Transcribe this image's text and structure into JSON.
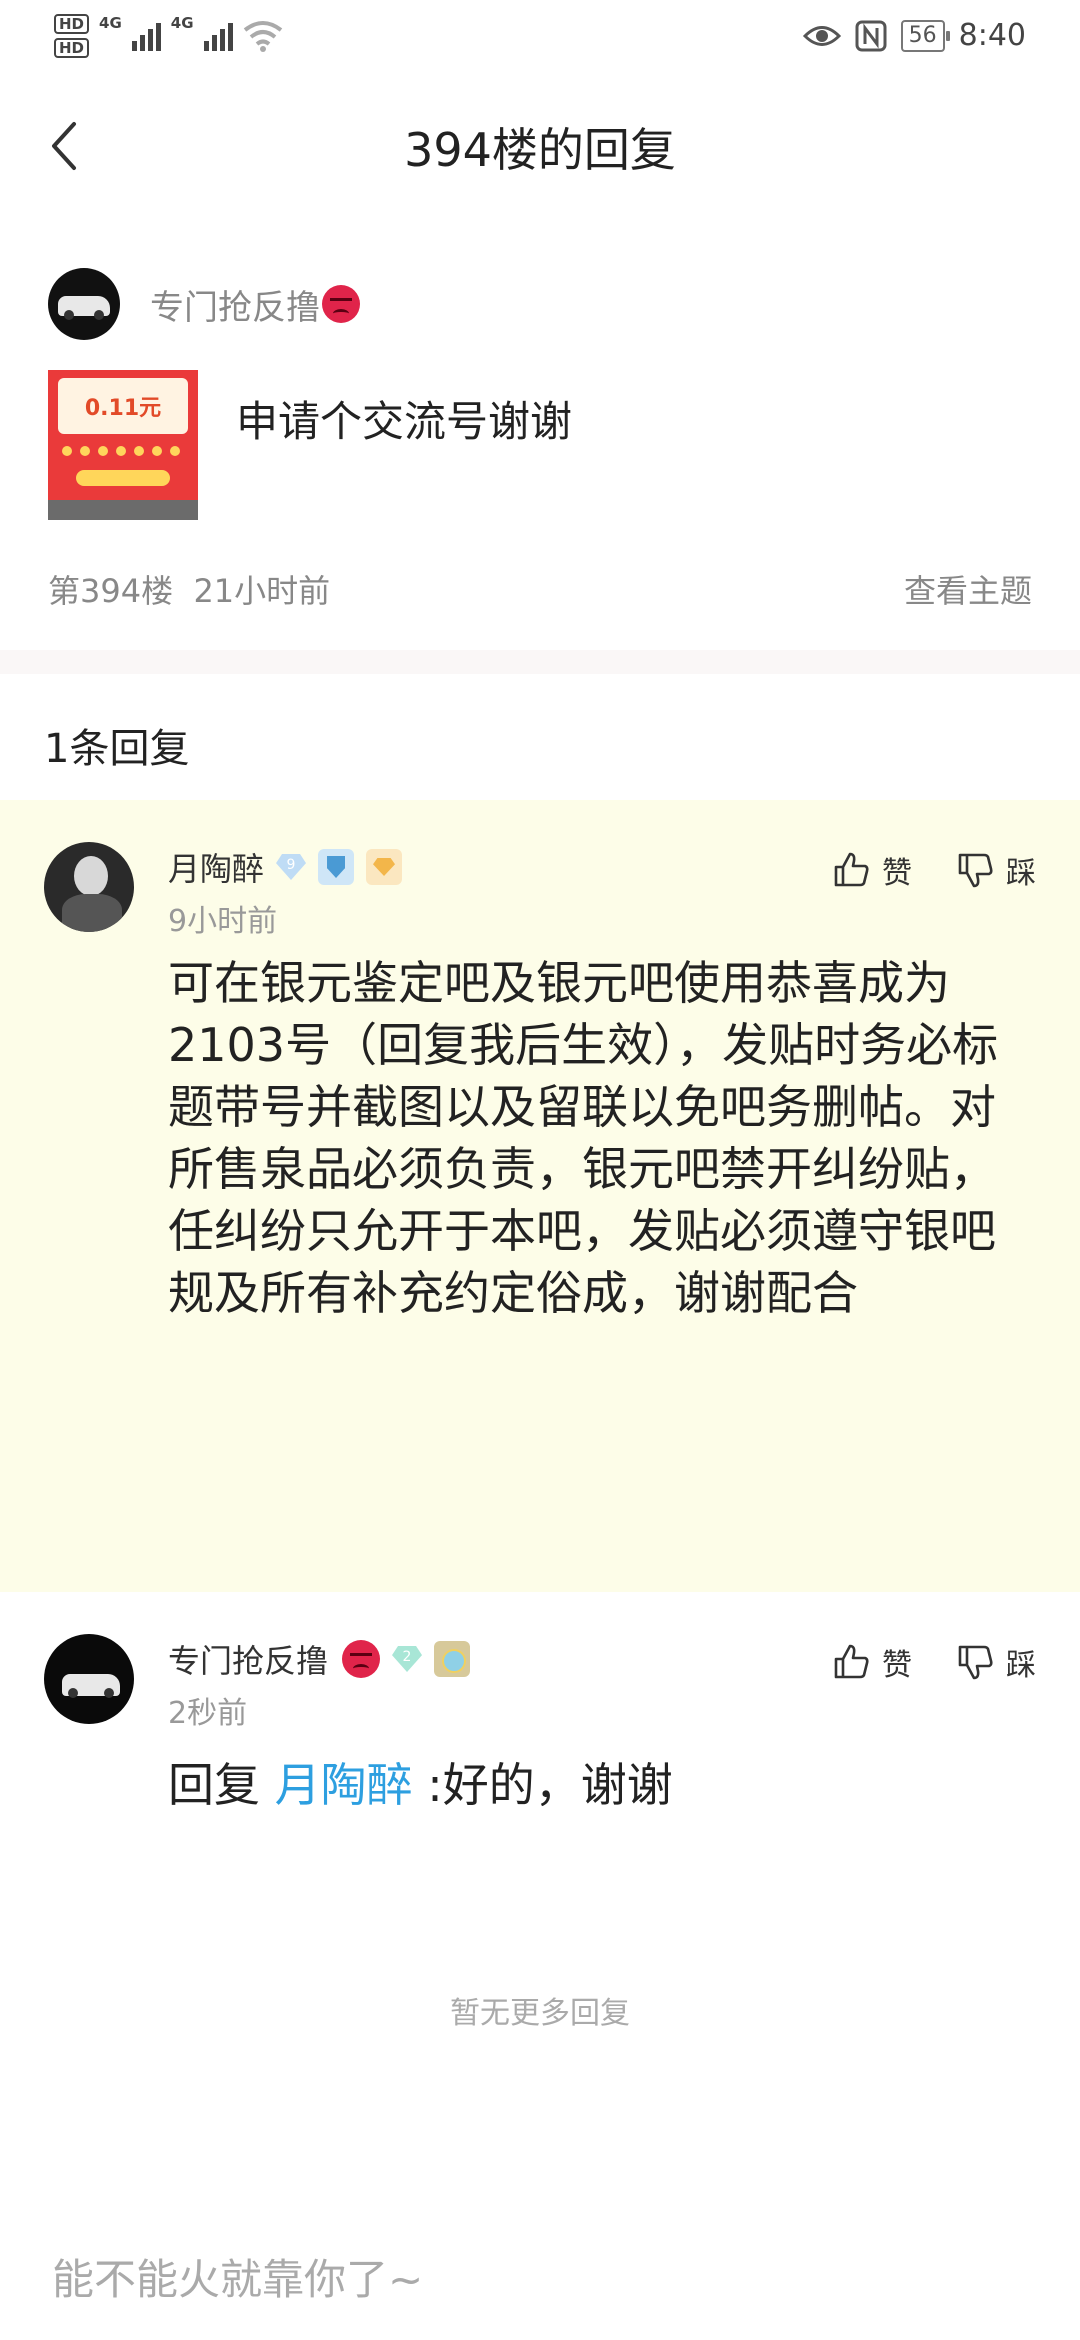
{
  "status_bar": {
    "hd_top": "HD",
    "hd_bottom": "HD",
    "net1": "4G",
    "net2": "4G",
    "battery": "56",
    "time": "8:40",
    "icons": [
      "eye-icon",
      "nfc-icon",
      "wifi-icon",
      "signal-icon"
    ]
  },
  "nav": {
    "title": "394楼的回复",
    "back_icon": "chevron-left-icon"
  },
  "post": {
    "author": "专门抢反撸",
    "text": "申请个交流号谢谢",
    "thumb_amount": "0.11元",
    "floor": "第394楼",
    "time": "21小时前",
    "view_topic": "查看主题"
  },
  "replies_count": "1条回复",
  "replies": [
    {
      "author": "月陶醉",
      "level": "9",
      "time": "9小时前",
      "like": "赞",
      "dislike": "踩",
      "body": "可在银元鉴定吧及银元吧使用恭喜成为2103号（回复我后生效），发贴时务必标题带号并截图以及留联以免吧务删帖。对所售泉品必须负责，银元吧禁开纠纷贴，任纠纷只允开于本吧，发贴必须遵守银吧规及所有补充约定俗成，谢谢配合"
    },
    {
      "author": "专门抢反撸",
      "level": "2",
      "time": "2秒前",
      "like": "赞",
      "dislike": "踩",
      "body_prefix": "回复",
      "mention": "月陶醉",
      "body_suffix": ":好的，谢谢"
    }
  ],
  "no_more": "暂无更多回复",
  "input": {
    "placeholder": "能不能火就靠你了~"
  },
  "colors": {
    "highlight_bg": "#fdfde8",
    "mention": "#2d9fe0",
    "meta_text": "#888888"
  }
}
